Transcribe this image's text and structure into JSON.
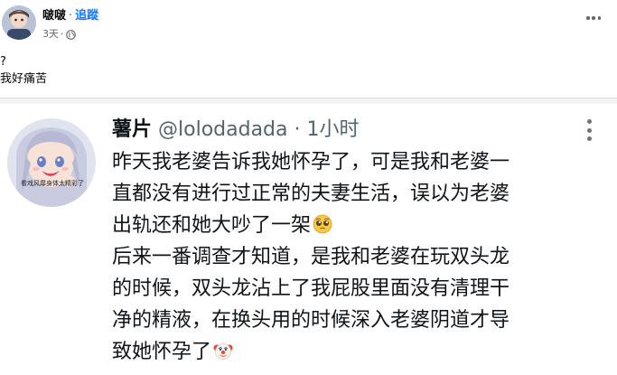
{
  "post": {
    "author": "啵啵",
    "separator": "·",
    "follow_label": "追蹤",
    "time": "3天",
    "meta_separator": "·",
    "privacy_icon": "globe-icon",
    "more_icon": "more-horizontal-icon",
    "text_lines": [
      "?",
      "我好痛苦"
    ]
  },
  "shared_post": {
    "display_name": "薯片",
    "handle": "@lolodadada",
    "separator": "·",
    "time": "1小时",
    "more_icon": "more-vertical-icon",
    "avatar_caption": "看戏风靡身体太精彩了",
    "body_lines": [
      "昨天我老婆告诉我她怀孕了，可是我和老婆一",
      "直都没有进行过正常的夫妻生活，误以为老婆",
      "出轨还和她大吵了一架",
      "后来一番调查才知道，是我和老婆在玩双头龙",
      "的时候，双头龙沾上了我屁股里面没有清理干",
      "净的精液，在换头用的时候深入老婆阴道才导",
      "致她怀孕了"
    ],
    "emoji_1": "pleading-face-emoji",
    "emoji_2": "clown-face-emoji"
  },
  "colors": {
    "link_blue": "#1877f2",
    "meta_gray": "#65676b",
    "handle_gray": "#536471",
    "text": "#0f1419"
  }
}
